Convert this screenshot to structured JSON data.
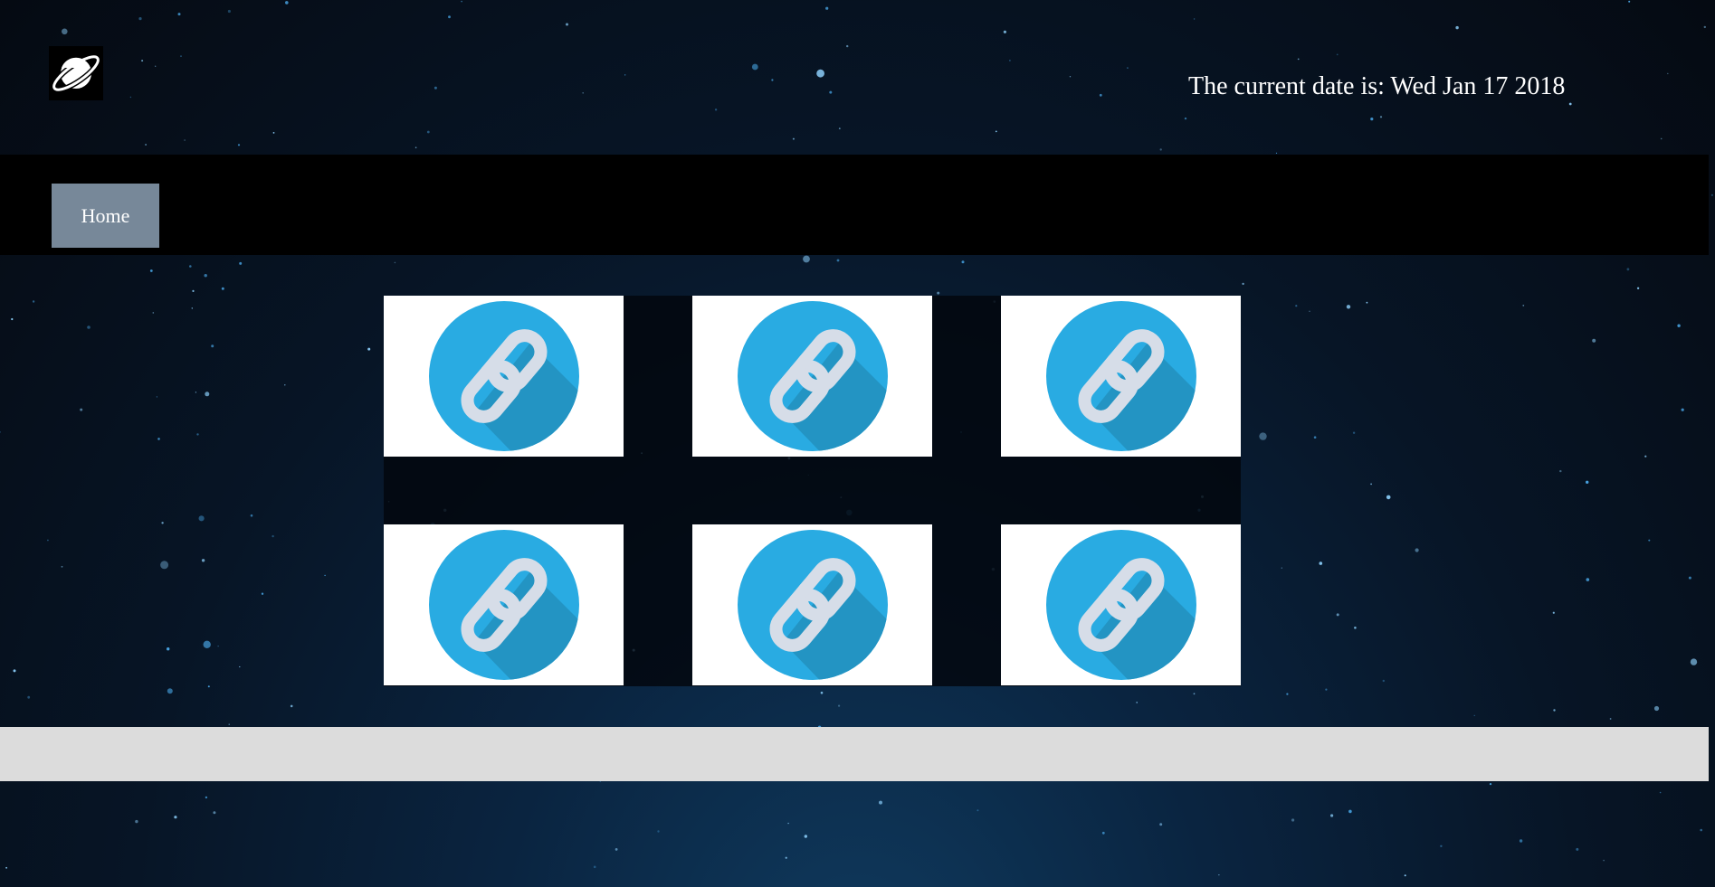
{
  "header": {
    "logo_icon": "planet-icon",
    "date_text": "The current date is: Wed Jan 17 2018"
  },
  "nav": {
    "items": [
      {
        "label": "Home"
      }
    ]
  },
  "link_grid": {
    "icon": "link-icon",
    "tile_count": 6
  },
  "colors": {
    "nav_active": "#778899",
    "icon_circle": "#29abe2",
    "icon_shadow": "#2394c3",
    "chain": "#d6dde8",
    "footer": "#dcdcdc"
  }
}
